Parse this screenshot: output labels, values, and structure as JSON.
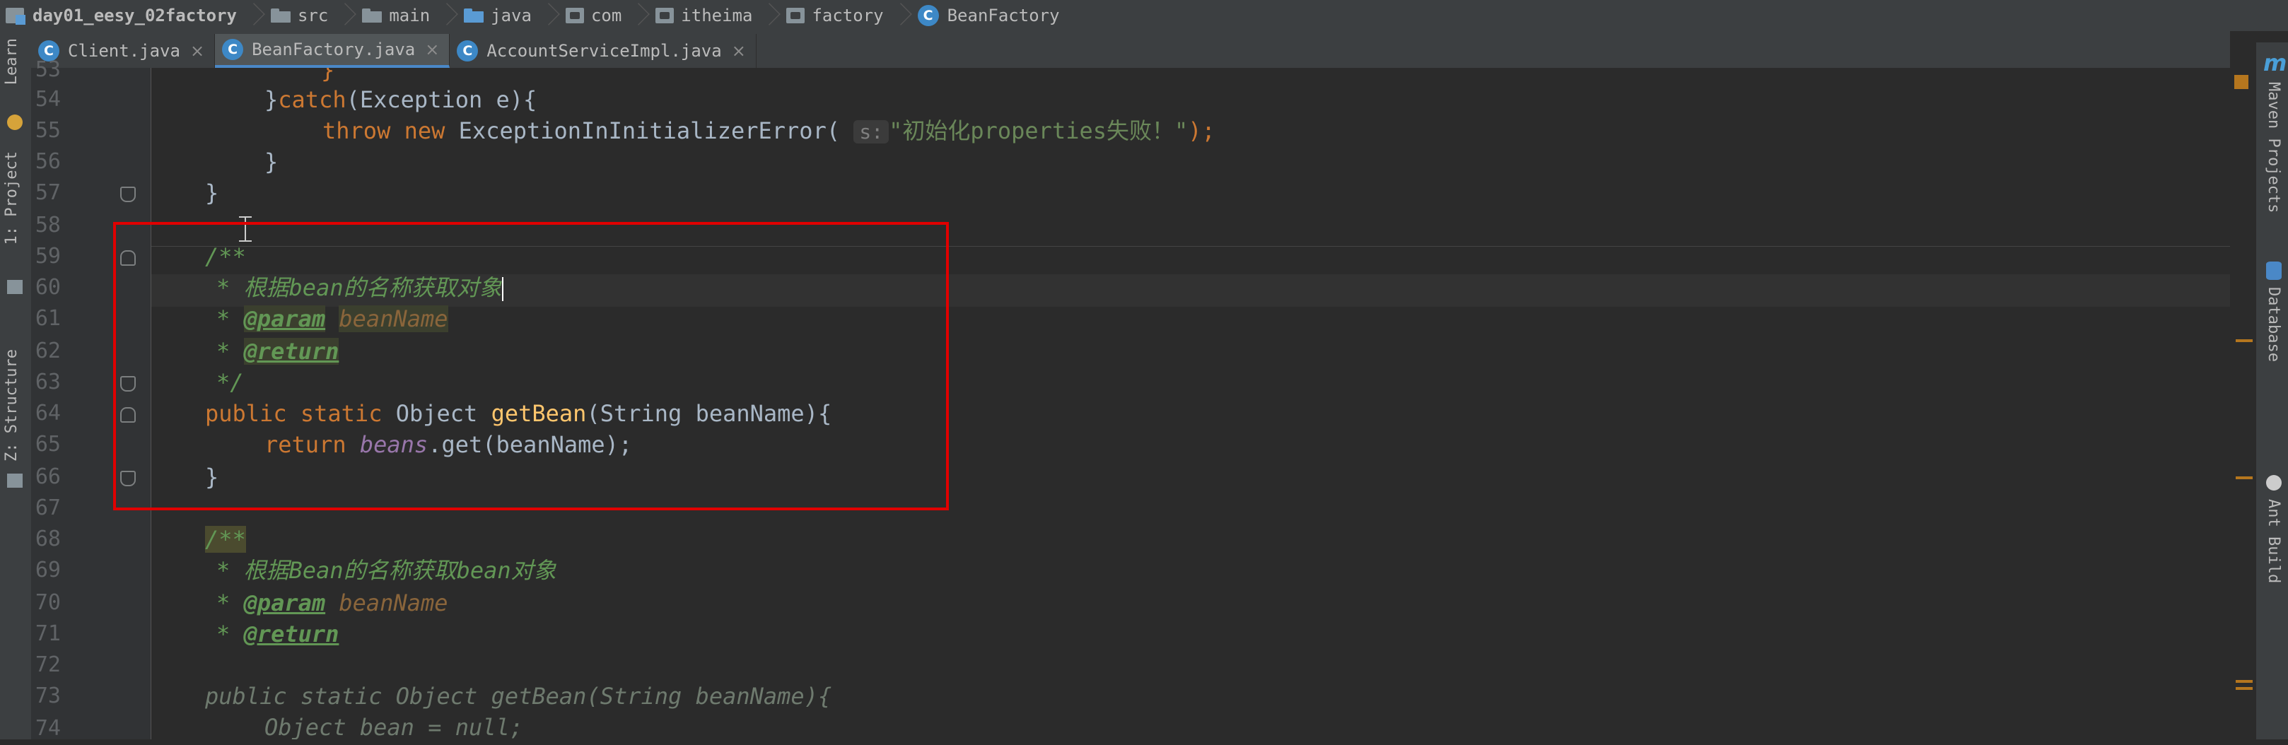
{
  "breadcrumb": [
    "day01_eesy_02factory",
    "src",
    "main",
    "java",
    "com",
    "itheima",
    "factory",
    "BeanFactory"
  ],
  "tabs": [
    {
      "label": "Client.java",
      "active": false
    },
    {
      "label": "BeanFactory.java",
      "active": true
    },
    {
      "label": "AccountServiceImpl.java",
      "active": false
    }
  ],
  "left_tools": {
    "learn": "Learn",
    "project": "1: Project",
    "structure": "Z: Structure"
  },
  "right_tools": {
    "maven": "Maven Projects",
    "database": "Database",
    "ant": "Ant Build"
  },
  "line_numbers": [
    "53",
    "54",
    "55",
    "56",
    "57",
    "58",
    "59",
    "60",
    "61",
    "62",
    "63",
    "64",
    "65",
    "66",
    "67",
    "68",
    "69",
    "70",
    "71",
    "72",
    "73",
    "74"
  ],
  "code": {
    "l53": "}",
    "l54_a": "}",
    "l54_kw": "catch",
    "l54_b": "(Exception e){",
    "l55_throw": "throw",
    "l55_new": "new",
    "l55_a": "ExceptionInInitializerError(",
    "l55_hint": "s:",
    "l55_str": "\"初始化properties失败！\"",
    "l55_b": ");",
    "l56": "}",
    "l57": "}",
    "l59": "/**",
    "l60": "* 根据bean的名称获取对象",
    "l61_star": "*",
    "l61_tag": "@param",
    "l61_name": "beanName",
    "l62_star": "*",
    "l62_tag": "@return",
    "l63": "*/",
    "l64_public": "public",
    "l64_static": "static",
    "l64_a": "Object",
    "l64_fn": "getBean",
    "l64_b": "(String beanName){",
    "l65_return": "return",
    "l65_field": "beans",
    "l65_b": ".get(beanName);",
    "l66": "}",
    "l68": "/**",
    "l69": "* 根据Bean的名称获取bean对象",
    "l70_star": "*",
    "l70_tag": "@param",
    "l70_name": "beanName",
    "l71_star": "*",
    "l71_tag": "@return",
    "l73": "public static Object getBean(String beanName){",
    "l74": "Object bean = null;"
  },
  "colors": {
    "highlight_box": "#e00000",
    "keyword": "#cc7832",
    "doc_comment": "#629755",
    "string": "#6a8759"
  }
}
